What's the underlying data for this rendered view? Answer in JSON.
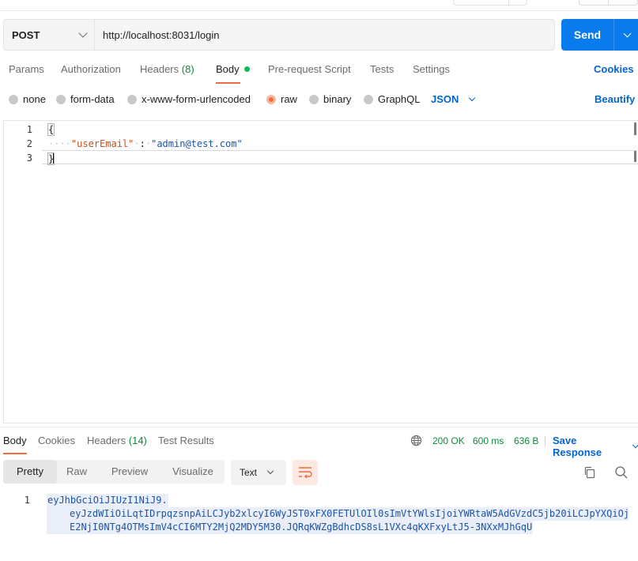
{
  "request": {
    "method": "POST",
    "url": "http://localhost:8031/login",
    "send_label": "Send"
  },
  "request_tabs": {
    "params": "Params",
    "authorization": "Authorization",
    "headers": "Headers",
    "headers_count": "(8)",
    "body": "Body",
    "pre_request": "Pre-request Script",
    "tests": "Tests",
    "settings": "Settings",
    "cookies": "Cookies",
    "active": "Body"
  },
  "body_options": {
    "none": "none",
    "form_data": "form-data",
    "urlencoded": "x-www-form-urlencoded",
    "raw": "raw",
    "binary": "binary",
    "graphql": "GraphQL",
    "format": "JSON",
    "beautify": "Beautify",
    "selected": "raw"
  },
  "editor": {
    "line_numbers": [
      "1",
      "2",
      "3"
    ],
    "open_brace": "{",
    "key": "\"userEmail\"",
    "colon": ":",
    "value": "\"admin@test.com\"",
    "close_brace": "}"
  },
  "response_tabs": {
    "body": "Body",
    "cookies": "Cookies",
    "headers": "Headers",
    "headers_count": "(14)",
    "test_results": "Test Results",
    "status": "200 OK",
    "time": "600 ms",
    "size": "636 B",
    "save_response": "Save Response"
  },
  "response_view": {
    "pretty": "Pretty",
    "raw": "Raw",
    "preview": "Preview",
    "visualize": "Visualize",
    "format": "Text",
    "active": "Pretty"
  },
  "response_body": {
    "line_number": "1",
    "line1": "eyJhbGciOiJIUzI1NiJ9.",
    "line2": "eyJzdWIiOiLqtIDrpqzsnpAiLCJyb2xlcyI6WyJST0xFX0FETUlOIl0sImVtYWlsIjoiYWRtaW5AdGVzdC5jb20iLCJpYXQiOj",
    "line3": "E2NjI0NTg4OTMsImV4cCI6MTY2MjQ2MDY5M30.JQRqKWZgBdhcDS8sL1VXc4qKXFxyLtJ5-3NXxMJhGqU"
  },
  "colors": {
    "accent_blue": "#097bed",
    "active_tab_underline": "#f26b3a",
    "status_green": "#0b8a3c",
    "link_blue": "#0265d2"
  }
}
